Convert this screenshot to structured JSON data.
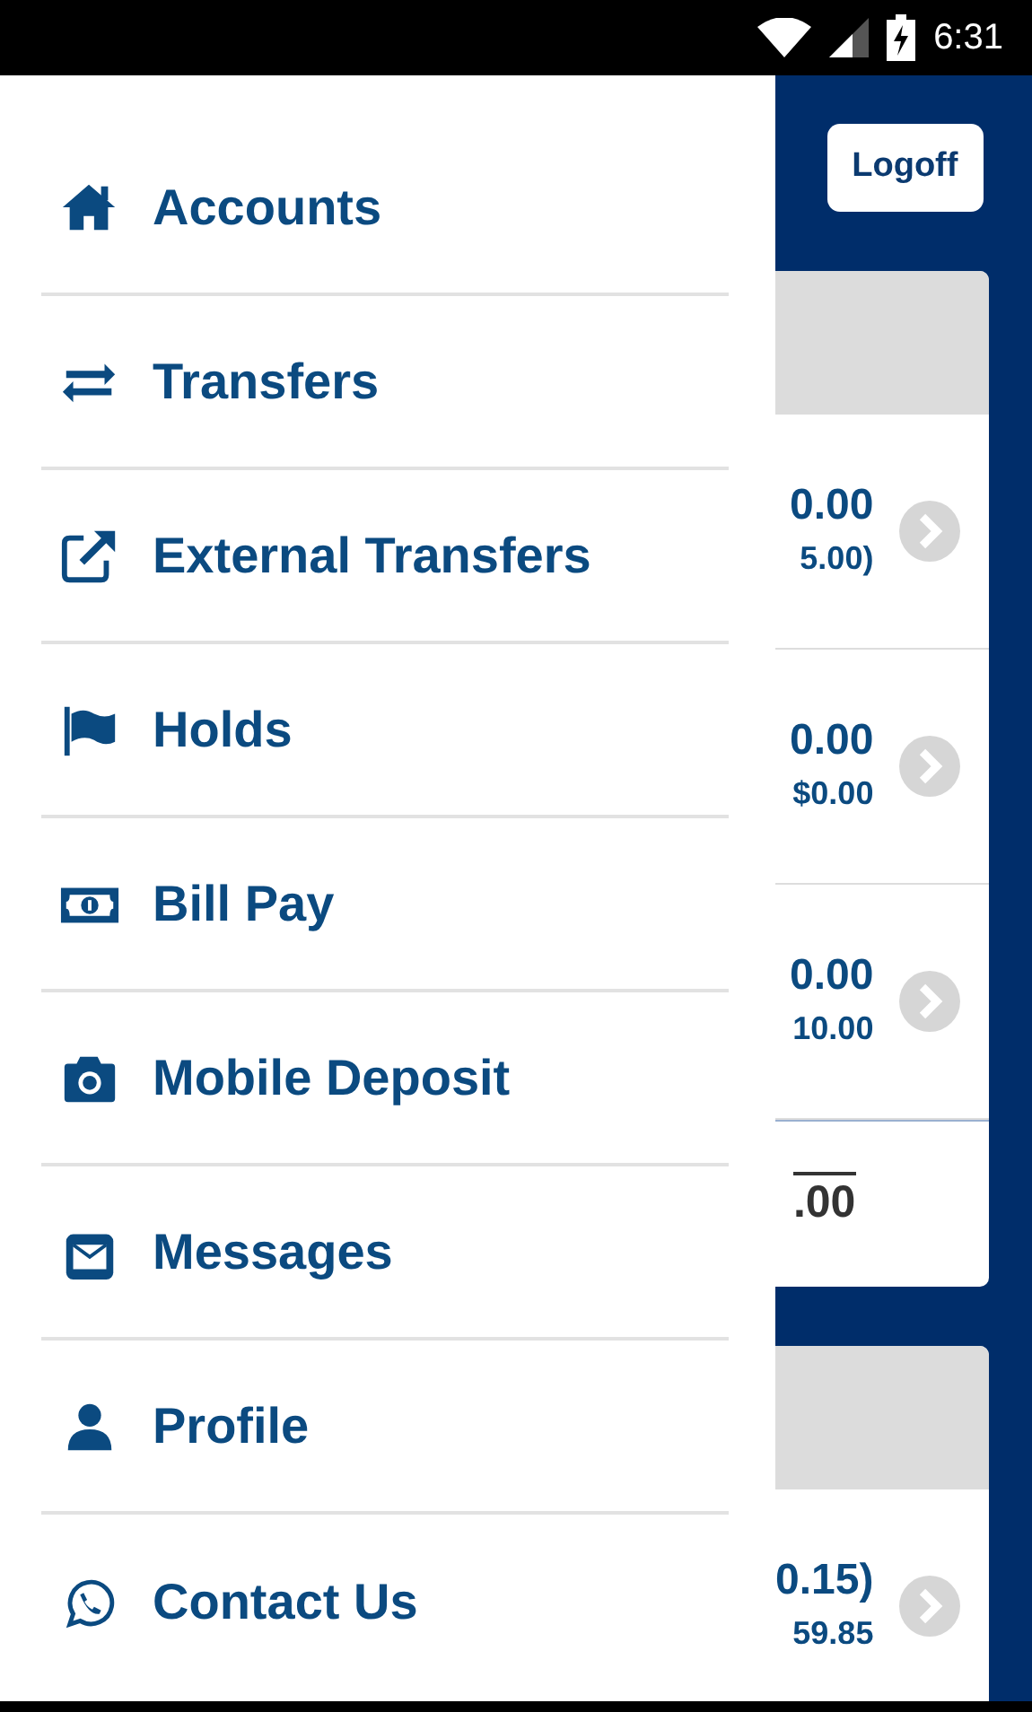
{
  "status_bar": {
    "time": "6:31"
  },
  "menu": [
    {
      "kind": "home",
      "label": "Accounts"
    },
    {
      "kind": "transfer",
      "label": "Transfers"
    },
    {
      "kind": "external",
      "label": "External Transfers"
    },
    {
      "kind": "flag",
      "label": "Holds"
    },
    {
      "kind": "bill",
      "label": "Bill Pay"
    },
    {
      "kind": "camera",
      "label": "Mobile Deposit"
    },
    {
      "kind": "mail",
      "label": "Messages"
    },
    {
      "kind": "person",
      "label": "Profile"
    },
    {
      "kind": "phone",
      "label": "Contact Us"
    }
  ],
  "logoff_button": "Logoff",
  "account_groups": [
    {
      "rows": [
        {
          "amount": "0.00",
          "available": "5.00)"
        },
        {
          "amount": "0.00",
          "available": "$0.00"
        },
        {
          "amount": "0.00",
          "available": "10.00"
        }
      ],
      "total": ".00"
    },
    {
      "rows": [
        {
          "amount": "0.15)",
          "available": "59.85"
        }
      ]
    }
  ]
}
